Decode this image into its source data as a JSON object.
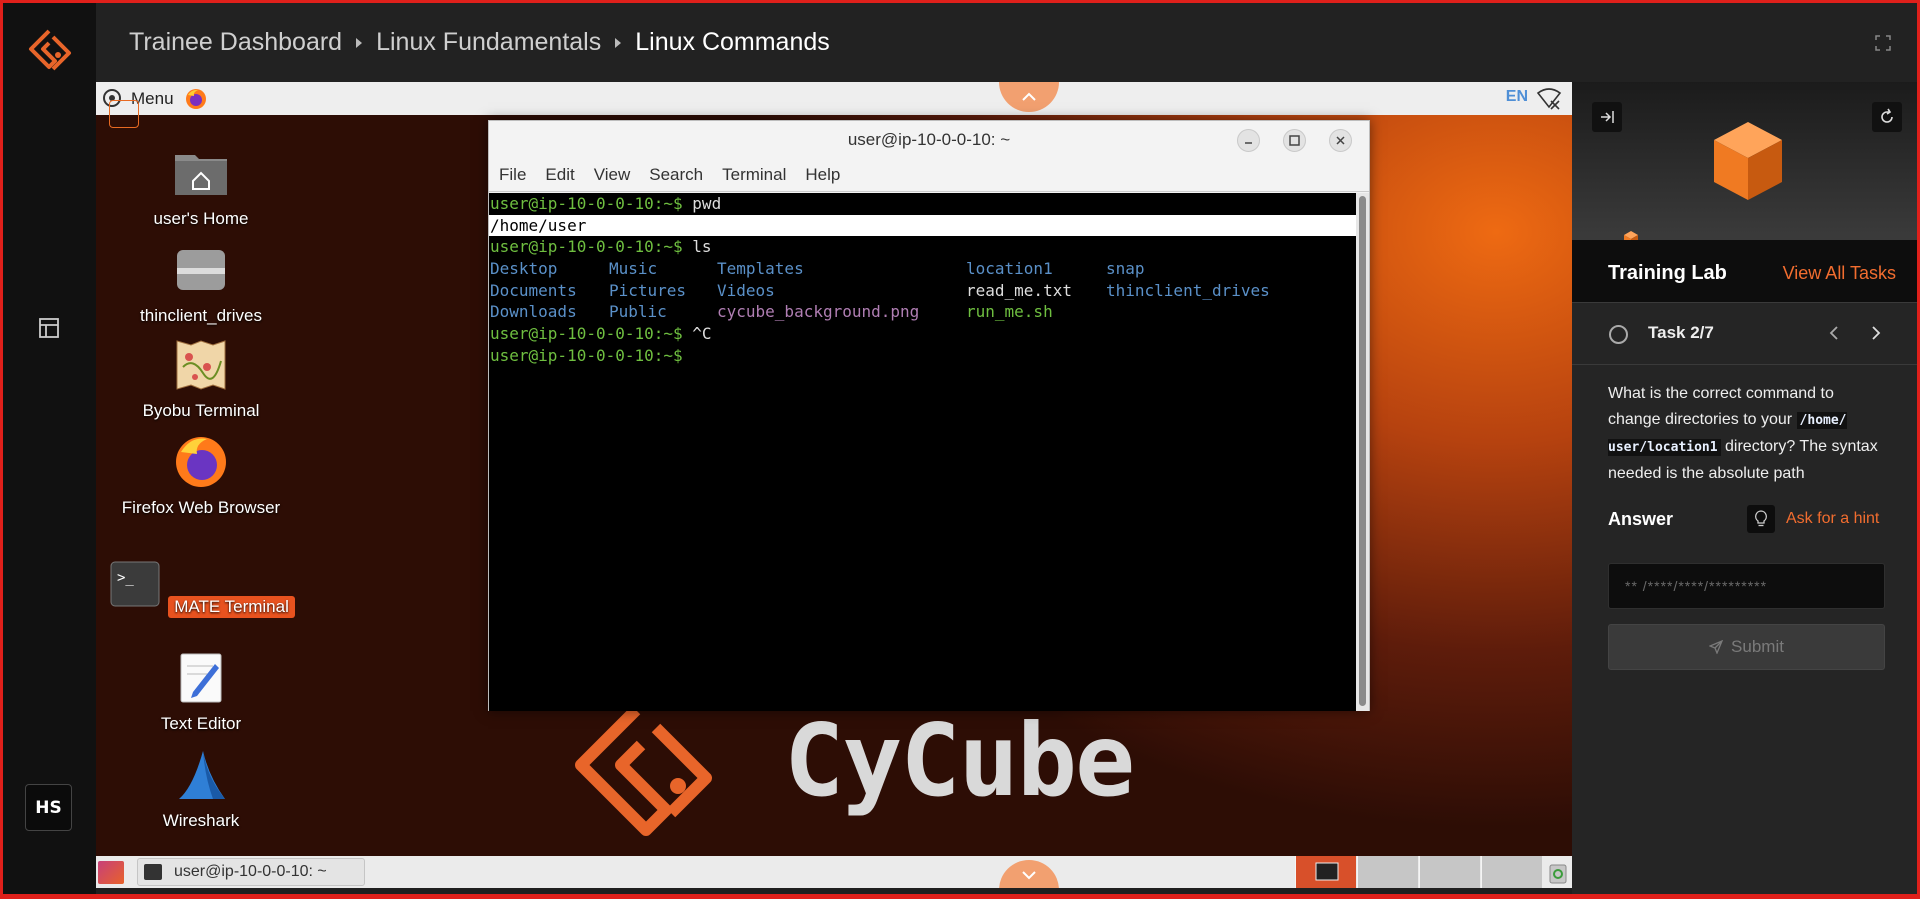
{
  "header": {
    "breadcrumbs": [
      "Trainee Dashboard",
      "Linux Fundamentals",
      "Linux Commands"
    ]
  },
  "rail": {
    "avatar_initials": "HS"
  },
  "desktop": {
    "topbar": {
      "menu_label": "Menu",
      "language": "EN"
    },
    "icons": [
      {
        "label": "user's Home"
      },
      {
        "label": "thinclient_drives"
      },
      {
        "label": "Byobu Terminal"
      },
      {
        "label": "Firefox Web Browser"
      },
      {
        "label": "MATE Terminal"
      },
      {
        "label": "Text Editor"
      },
      {
        "label": "Wireshark"
      }
    ],
    "brand_text": "CyCube"
  },
  "terminal": {
    "title": "user@ip-10-0-0-10: ~",
    "menu": [
      "File",
      "Edit",
      "View",
      "Search",
      "Terminal",
      "Help"
    ],
    "prompt": "user@ip-10-0-0-10:~$",
    "cmd1": "pwd",
    "out1": "/home/user",
    "cmd2": "ls",
    "ls": {
      "r1": [
        "Desktop",
        "Music",
        "Templates",
        "location1",
        "snap"
      ],
      "r2": [
        "Documents",
        "Pictures",
        "Videos",
        "read_me.txt",
        "thinclient_drives"
      ],
      "r3": [
        "Downloads",
        "Public",
        "cycube_background.png",
        "run_me.sh"
      ]
    },
    "cmd3": "^C"
  },
  "taskbar": {
    "task_label": "user@ip-10-0-0-10: ~"
  },
  "panel": {
    "lab_title": "Training Lab",
    "view_all": "View All Tasks",
    "task_label": "Task 2/7",
    "progress_fraction": 0,
    "question_part1": "What is the correct command to change directories to your ",
    "question_code": "/home/ user/location1",
    "question_part2": " directory? The syntax needed is the absolute path",
    "answer_label": "Answer",
    "hint_label": "Ask for a hint",
    "answer_placeholder": "** /****/****/*********",
    "submit_label": "Submit"
  },
  "colors": {
    "accent": "#f26d2f",
    "prompt_green": "#6fbf40",
    "dir_blue": "#5a90c8",
    "frame_red": "#e0201b"
  }
}
